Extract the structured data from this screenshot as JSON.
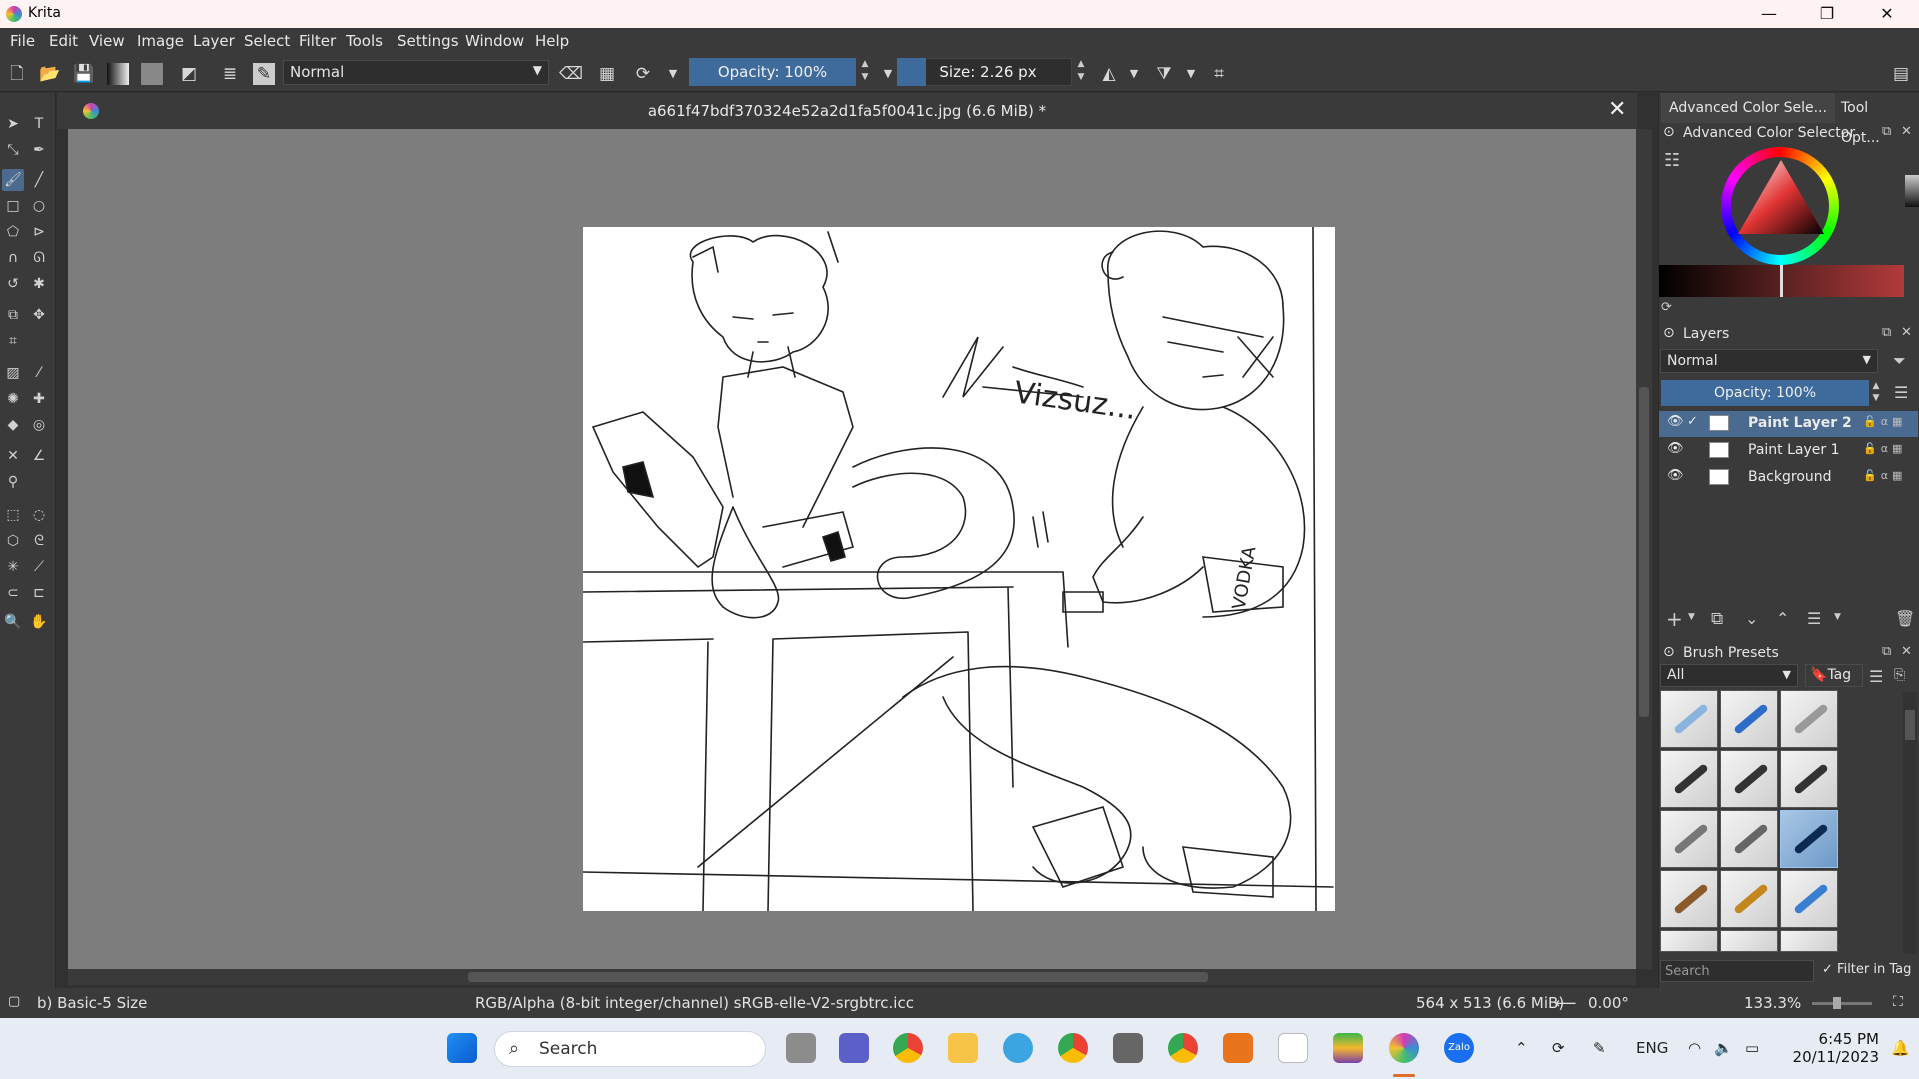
{
  "window": {
    "app_title": "Krita",
    "minimize": "—",
    "maximize": "❐",
    "close": "✕"
  },
  "menu": [
    "File",
    "Edit",
    "View",
    "Image",
    "Layer",
    "Select",
    "Filter",
    "Tools",
    "Settings",
    "Window",
    "Help"
  ],
  "toolbar": {
    "blend_mode": "Normal",
    "opacity_label": "Opacity: 100%",
    "size_label": "Size: 2.26 px",
    "size_level": 0.13
  },
  "document": {
    "title": "a661f47bdf370324e52a2d1fa5f0041c.jpg (6.6 MiB) *",
    "close": "✕"
  },
  "docker": {
    "tabs": [
      "Advanced Color Sele...",
      "Tool Opt..."
    ],
    "color_selector_title": "Advanced Color Selector",
    "layers_title": "Layers",
    "layers_blend": "Normal",
    "layers_opacity": "Opacity:  100%",
    "layers": [
      {
        "name": "Paint Layer 2",
        "selected": true
      },
      {
        "name": "Paint Layer 1",
        "selected": false
      },
      {
        "name": "Background",
        "selected": false
      }
    ],
    "brush_presets_title": "Brush Presets",
    "brush_filter": "All",
    "brush_tag": "Tag",
    "brush_search_placeholder": "Search",
    "filter_in_tag": "Filter in Tag",
    "filter_in_tag_checked": true
  },
  "status": {
    "brush": "b) Basic-5 Size",
    "color_space": "RGB/Alpha (8-bit integer/channel)  sRGB-elle-V2-srgbtrc.icc",
    "dimensions": "564 x 513 (6.6 MiB)",
    "rotation": "0.00°",
    "zoom": "133.3%"
  },
  "taskbar": {
    "search_placeholder": "Search",
    "language": "ENG",
    "time": "6:45 PM",
    "date": "20/11/2023",
    "zalo_label": "Zalo"
  },
  "colors": {
    "accent": "#4a6b8f",
    "slider_fill": "#3e6b9c",
    "canvas_bg": "#7d7d7d",
    "panel": "#3a3a3a"
  }
}
